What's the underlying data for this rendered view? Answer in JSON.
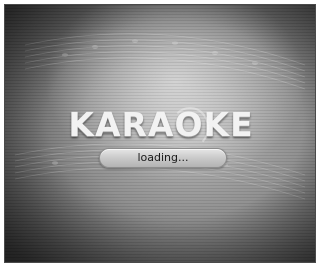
{
  "logo": {
    "text_before": "KARA",
    "text_ring": "O",
    "text_after": "KE"
  },
  "loading": {
    "label": "loading..."
  },
  "colors": {
    "logo_text": "#f2f2f2",
    "background_dark": "#3a3a3a",
    "background_light": "#b8b8b8",
    "pill": "#c9c9c9"
  },
  "icons": {
    "background": "sheet-music-image"
  }
}
